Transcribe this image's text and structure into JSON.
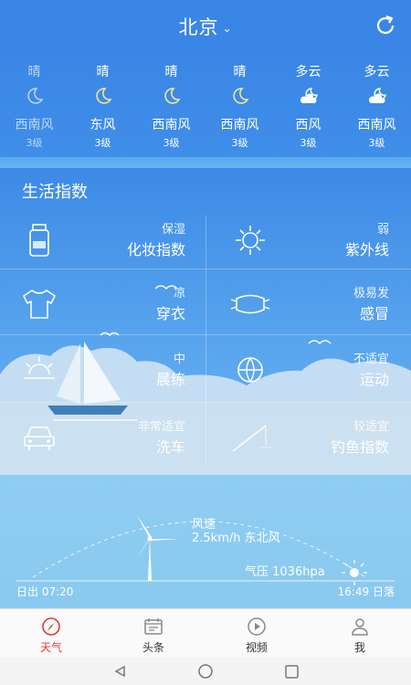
{
  "header": {
    "city": "北京",
    "caret_icon": "chevron-down-icon",
    "refresh_icon": "refresh-icon"
  },
  "forecast": [
    {
      "condition": "晴",
      "icon": "moon-icon",
      "wind": "西南风",
      "level": "3级"
    },
    {
      "condition": "晴",
      "icon": "moon-icon",
      "wind": "东风",
      "level": "3级"
    },
    {
      "condition": "晴",
      "icon": "moon-icon",
      "wind": "西南风",
      "level": "3级"
    },
    {
      "condition": "晴",
      "icon": "moon-icon",
      "wind": "西南风",
      "level": "3级"
    },
    {
      "condition": "多云",
      "icon": "moon-cloud-icon",
      "wind": "西风",
      "level": "3级"
    },
    {
      "condition": "多云",
      "icon": "moon-cloud-icon",
      "wind": "西南风",
      "level": "3级"
    }
  ],
  "life": {
    "title": "生活指数",
    "items": [
      {
        "sub": "保湿",
        "main": "化妆指数",
        "icon": "cosmetic-jar-icon"
      },
      {
        "sub": "弱",
        "main": "紫外线",
        "icon": "sun-icon"
      },
      {
        "sub": "凉",
        "main": "穿衣",
        "icon": "tshirt-icon"
      },
      {
        "sub": "极易发",
        "main": "感冒",
        "icon": "mask-icon"
      },
      {
        "sub": "中",
        "main": "晨练",
        "icon": "sunrise-icon"
      },
      {
        "sub": "不适宜",
        "main": "运动",
        "icon": "ball-icon"
      },
      {
        "sub": "非常适宜",
        "main": "洗车",
        "icon": "car-icon"
      },
      {
        "sub": "较适宜",
        "main": "钓鱼指数",
        "icon": "fishing-rod-icon"
      }
    ]
  },
  "sun": {
    "wind_label": "风速",
    "wind_value": "2.5km/h 东北风",
    "pressure": "气压 1036hpa",
    "sunrise": "日出 07:20",
    "sunset": "16:49 日落"
  },
  "nav": [
    {
      "label": "天气",
      "icon": "compass-icon",
      "active": true
    },
    {
      "label": "头条",
      "icon": "news-icon",
      "active": false
    },
    {
      "label": "视频",
      "icon": "play-icon",
      "active": false
    },
    {
      "label": "我",
      "icon": "person-icon",
      "active": false
    }
  ],
  "colors": {
    "primary": "#3a86e6",
    "active": "#e23b2e",
    "sky": "#8fcdf2"
  }
}
